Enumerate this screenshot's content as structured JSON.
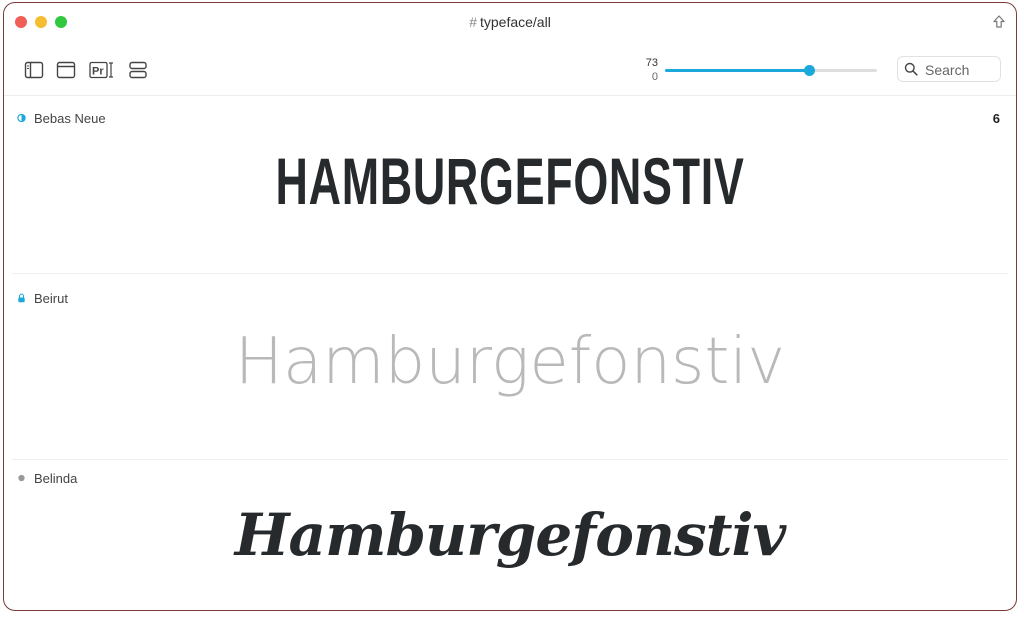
{
  "window": {
    "title": "typeface/all",
    "title_prefix": "#"
  },
  "toolbar": {
    "icons": [
      "sidebar-icon",
      "window-icon",
      "preview-text-icon",
      "list-view-icon"
    ],
    "preview_icon_text": "Pr",
    "slider": {
      "value": 73,
      "min_label": "0",
      "max_label": "73",
      "fraction": 0.68
    },
    "search": {
      "placeholder": "Search"
    }
  },
  "colors": {
    "accent": "#1ba8db",
    "sample_dark": "#262a2c",
    "sample_light": "#b9b9b9",
    "bullet_gray": "#999999"
  },
  "fonts": [
    {
      "name": "Bebas Neue",
      "count": "6",
      "sample": "HAMBURGEFONSTIV",
      "bullet": "half-circle-icon"
    },
    {
      "name": "Beirut",
      "count": "",
      "sample": "Hamburgefonstiv",
      "bullet": "lock-icon"
    },
    {
      "name": "Belinda",
      "count": "",
      "sample": "Hamburgefonstiv",
      "bullet": "dot-icon"
    }
  ]
}
